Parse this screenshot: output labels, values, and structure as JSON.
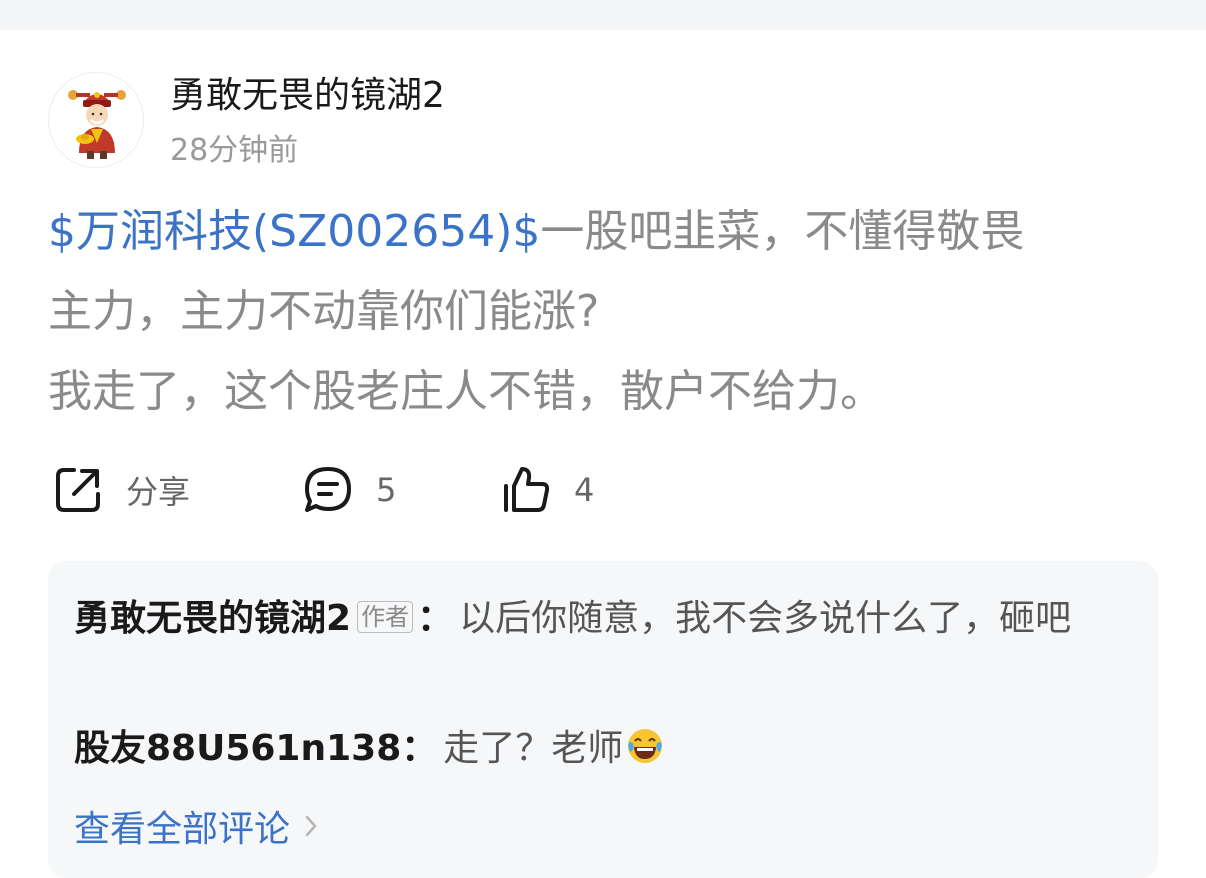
{
  "post": {
    "username": "勇敢无畏的镜湖2",
    "time": "28分钟前",
    "stock_tag": "$万润科技(SZ002654)$",
    "body_line1_rest": "一股吧韭菜，不懂得敬畏",
    "body_line2": "主力，主力不动靠你们能涨?",
    "body_line3": "我走了，这个股老庄人不错，散户不给力。"
  },
  "actions": {
    "share_label": "分享",
    "comment_count": "5",
    "like_count": "4"
  },
  "comments": {
    "items": [
      {
        "author": "勇敢无畏的镜湖2",
        "badge": "作者",
        "colon": "：",
        "text": "以后你随意，我不会多说什么了，砸吧"
      },
      {
        "author": "股友88U561n138",
        "colon": "：",
        "text": "走了？老师"
      }
    ],
    "view_all_label": "查看全部评论"
  },
  "colors": {
    "link": "#3b73c8",
    "body_text": "#8a8a8a",
    "comment_bg": "#f6f7f9"
  },
  "icons": {
    "share": "share-icon",
    "comment": "comment-icon",
    "like": "thumbs-up-icon",
    "emoji": "laughing-tears-emoji-icon",
    "chevron": "chevron-right-icon"
  }
}
